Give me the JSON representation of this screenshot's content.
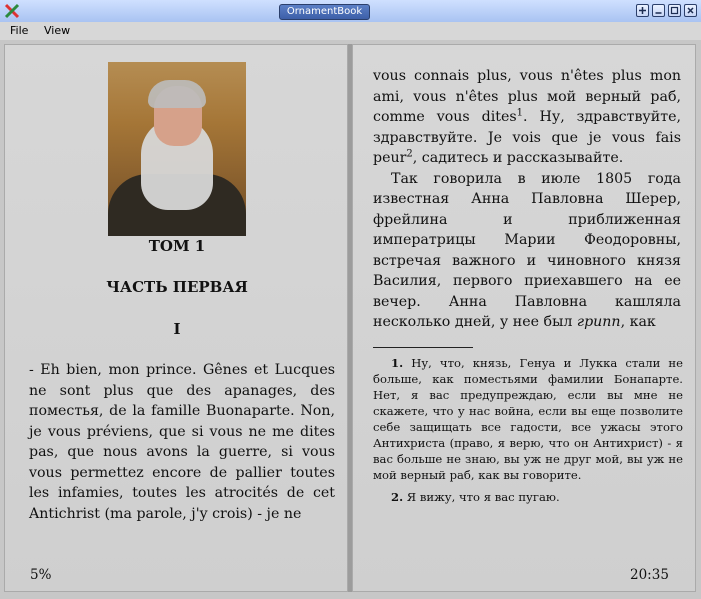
{
  "window": {
    "title": "OrnamentBook"
  },
  "menu": {
    "items": [
      {
        "label": "File"
      },
      {
        "label": "View"
      }
    ]
  },
  "left_page": {
    "heading_tom": "ТОМ 1",
    "heading_part": "ЧАСТЬ ПЕРВАЯ",
    "heading_chapter": "I",
    "paragraph": "- Eh bien, mon prince. Gênes et Lucques ne sont plus que des apanages, des поместья, de la famille Buonaparte. Non, je vous préviens, que si vous ne me dites pas, que nous avons la guerre, si vous vous permettez encore de pallier toutes les infamies, toutes les atrocités de cet Antichrist (ma parole, j'y crois) - je ne",
    "progress_label": "5%"
  },
  "right_page": {
    "para1_a": "vous connais plus, vous n'êtes plus mon ami, vous n'êtes plus мой верный раб, comme vous dites",
    "para1_sup1": "1",
    "para1_b": ". Ну, здравствуйте, здравствуйте. Je vois que je vous fais peur",
    "para1_sup2": "2",
    "para1_c": ", садитесь и рассказывайте.",
    "para2_a": "Так говорила в июле 1805 года известная Анна Павловна Шерер, фрейлина и приближенная императрицы Марии Феодоровны, встречая важного и чиновного князя Василия, первого приехавшего на ее вечер. Анна Павловна кашляла несколько дней, у нее был ",
    "para2_italic": "грипп",
    "para2_b": ", как",
    "footnote1_num": "1.",
    "footnote1_text": " Ну, что, князь, Генуа и Лукка стали не больше, как поместьями фамилии Бонапарте. Нет, я вас предупреждаю, если вы мне не скажете, что у нас война, если вы еще позволите себе защищать все гадости, все ужасы этого Антихриста (право, я верю, что он Антихрист) - я вас больше не знаю, вы уж не друг мой, вы уж не мой верный раб, как вы говорите.",
    "footnote2_num": "2.",
    "footnote2_text": " Я вижу, что я вас пугаю.",
    "clock": "20:35"
  },
  "colors": {
    "titlebar": "#a9c3f2",
    "page_bg": "#d2d2d2",
    "text": "#111111"
  },
  "icons": {
    "app": "x-logo-icon",
    "window_buttons": [
      "plus-icon",
      "minimize-icon",
      "restore-icon",
      "close-icon"
    ]
  }
}
